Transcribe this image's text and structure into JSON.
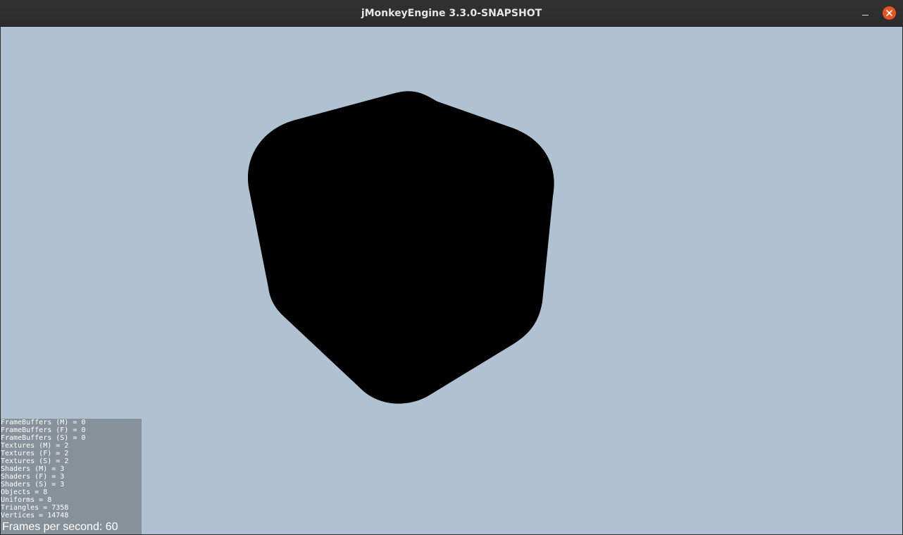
{
  "window": {
    "title": "jMonkeyEngine 3.3.0-SNAPSHOT",
    "minimize_icon": "minimize-icon",
    "close_icon": "close-icon",
    "close_color": "#e95420"
  },
  "scene": {
    "background_color": "#b0c1d2",
    "object_color": "#000000",
    "object_description_icon": "rounded-cube"
  },
  "stats": {
    "lines": [
      "FrameBuffers (M) = 0",
      "FrameBuffers (F) = 0",
      "FrameBuffers (S) = 0",
      "Textures (M) = 2",
      "Textures (F) = 2",
      "Textures (S) = 2",
      "Shaders (M) = 3",
      "Shaders (F) = 3",
      "Shaders (S) = 3",
      "Objects = 8",
      "Uniforms = 8",
      "Triangles = 7358",
      "Vertices = 14748"
    ],
    "fps_text": "Frames per second: 60"
  }
}
